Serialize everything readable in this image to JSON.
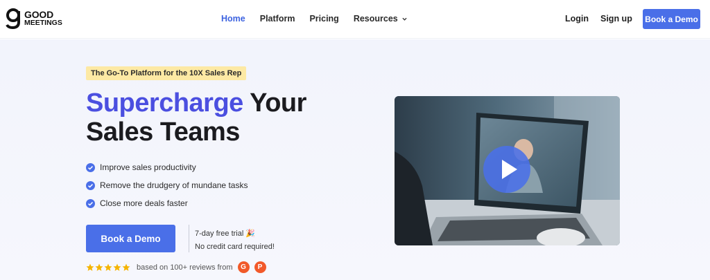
{
  "nav": {
    "logo_line1": "GOOD",
    "logo_line2": "MEETINGS",
    "items": [
      {
        "label": "Home"
      },
      {
        "label": "Platform"
      },
      {
        "label": "Pricing"
      },
      {
        "label": "Resources"
      }
    ],
    "login": "Login",
    "signup": "Sign up",
    "cta": "Book a Demo"
  },
  "hero": {
    "tag": "The Go-To Platform for the 10X Sales Rep",
    "title_accent": "Supercharge",
    "title_rest1": " Your",
    "title_rest2": "Sales Teams",
    "bullets": [
      "Improve sales productivity",
      "Remove the drudgery of mundane tasks",
      "Close more deals faster"
    ],
    "cta": "Book a Demo",
    "trial_line1": "7-day free trial",
    "trial_line2": "No credit card required!",
    "reviews_text": "based on 100+ reviews from",
    "rating": 5,
    "badge1": "G",
    "badge2": "P"
  },
  "colors": {
    "accent": "#4b4fe0",
    "button": "#4a6fe8",
    "tag_bg": "#fde9a4",
    "star": "#f5b400"
  },
  "icons": {
    "check": "check-circle-icon",
    "star": "star-icon",
    "play": "play-icon"
  }
}
